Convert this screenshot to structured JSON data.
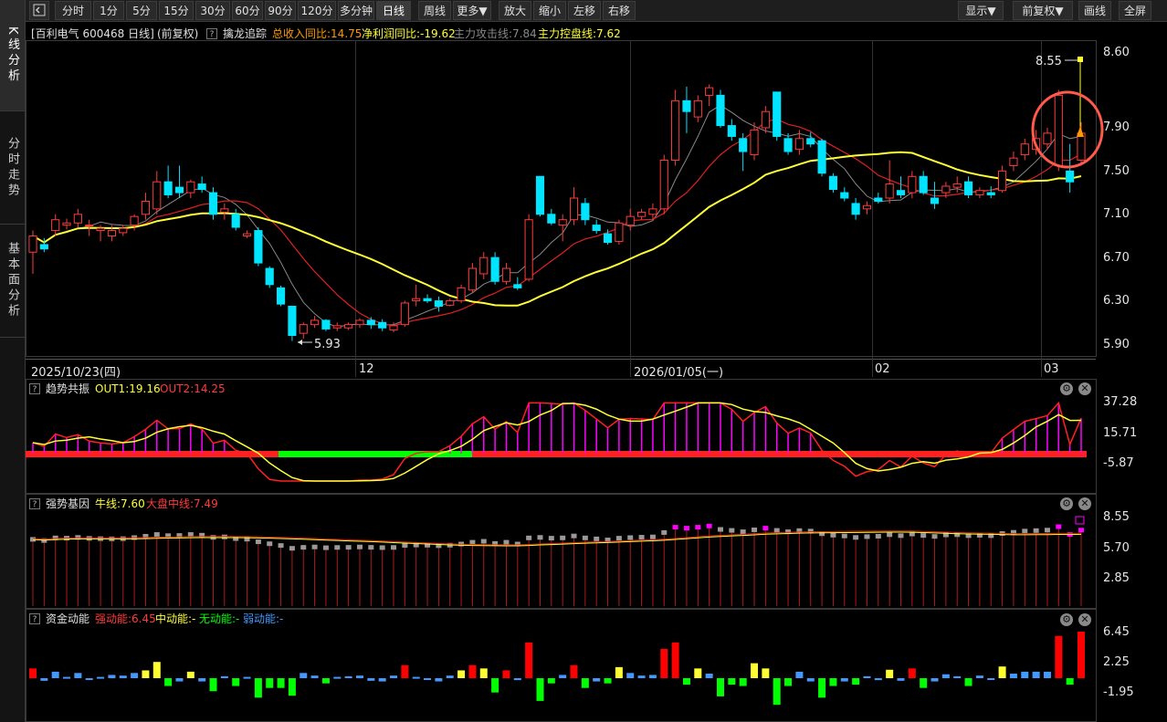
{
  "left_tabs": [
    "K线分析",
    "分时走势",
    "基本面分析"
  ],
  "toolbar": {
    "periods": [
      "分时",
      "1分",
      "5分",
      "15分",
      "30分",
      "60分",
      "90分",
      "120分",
      "多分钟",
      "日线",
      "周线",
      "更多▼",
      "放大",
      "缩小",
      "左移",
      "右移"
    ],
    "selected": "日线",
    "right_buttons": [
      "显示▼",
      "前复权▼",
      "画线",
      "全屏"
    ]
  },
  "main_panel": {
    "stock_label": "[百利电气 600468 日线]",
    "adjust_label": "(前复权)",
    "indicator_name": "擒龙追踪",
    "revenue_yoy": "总收入同比:14.75",
    "profit_yoy": "净利润同比:-19.62",
    "attack_line": "主力攻击线:7.84",
    "control_line": "主力控盘线:7.62",
    "y_ticks": [
      "8.60",
      "7.90",
      "7.50",
      "7.10",
      "6.70",
      "6.30",
      "5.90"
    ],
    "high_marker": "8.55",
    "low_marker": "5.93",
    "x_ticks": [
      "2025/10/23(四)",
      "12",
      "2026/01/05(一)",
      "02",
      "03"
    ]
  },
  "panel2": {
    "name": "趋势共振",
    "out1": "OUT1:19.16",
    "out2": "OUT2:14.25",
    "y_ticks": [
      "37.28",
      "15.71",
      "-5.87"
    ]
  },
  "panel3": {
    "name": "强势基因",
    "bull_line": "牛线:7.60",
    "market_mid": "大盘中线:7.49",
    "y_ticks": [
      "8.55",
      "5.70",
      "2.85"
    ]
  },
  "panel4": {
    "name": "资金动能",
    "strong": "强动能:6.45",
    "mid": "中动能:-",
    "none": "无动能:-",
    "weak": "弱动能:-",
    "y_ticks": [
      "6.45",
      "2.25",
      "-1.95"
    ]
  },
  "colors": {
    "up": "#ff3b3b",
    "down": "#00e5ff",
    "yellow": "#ffff33",
    "magenta": "#ff00ff",
    "green": "#00ff00",
    "orange": "#ff9900",
    "blue": "#4499ff"
  },
  "chart_data": {
    "type": "candlestick",
    "y_range": [
      5.9,
      8.6
    ],
    "bars": [
      {
        "o": 6.75,
        "h": 6.95,
        "l": 6.55,
        "c": 6.9
      },
      {
        "o": 6.82,
        "h": 6.88,
        "l": 6.75,
        "c": 6.78
      },
      {
        "o": 6.95,
        "h": 7.1,
        "l": 6.9,
        "c": 7.05
      },
      {
        "o": 7.0,
        "h": 7.06,
        "l": 6.96,
        "c": 7.02
      },
      {
        "o": 7.02,
        "h": 7.15,
        "l": 6.98,
        "c": 7.1
      },
      {
        "o": 7.0,
        "h": 7.05,
        "l": 6.9,
        "c": 7.0
      },
      {
        "o": 6.95,
        "h": 7.0,
        "l": 6.85,
        "c": 6.97
      },
      {
        "o": 6.9,
        "h": 7.0,
        "l": 6.85,
        "c": 6.95
      },
      {
        "o": 6.93,
        "h": 7.0,
        "l": 6.9,
        "c": 6.97
      },
      {
        "o": 7.0,
        "h": 7.1,
        "l": 6.95,
        "c": 7.08
      },
      {
        "o": 7.1,
        "h": 7.3,
        "l": 7.05,
        "c": 7.22
      },
      {
        "o": 7.15,
        "h": 7.5,
        "l": 7.1,
        "c": 7.4
      },
      {
        "o": 7.4,
        "h": 7.55,
        "l": 7.25,
        "c": 7.28
      },
      {
        "o": 7.35,
        "h": 7.55,
        "l": 7.25,
        "c": 7.3
      },
      {
        "o": 7.3,
        "h": 7.42,
        "l": 7.25,
        "c": 7.4
      },
      {
        "o": 7.38,
        "h": 7.45,
        "l": 7.3,
        "c": 7.33
      },
      {
        "o": 7.3,
        "h": 7.35,
        "l": 7.05,
        "c": 7.1
      },
      {
        "o": 7.12,
        "h": 7.2,
        "l": 7.05,
        "c": 7.15
      },
      {
        "o": 7.1,
        "h": 7.15,
        "l": 6.95,
        "c": 6.98
      },
      {
        "o": 6.9,
        "h": 6.95,
        "l": 6.88,
        "c": 6.92
      },
      {
        "o": 6.95,
        "h": 6.98,
        "l": 6.62,
        "c": 6.65
      },
      {
        "o": 6.6,
        "h": 6.62,
        "l": 6.42,
        "c": 6.45
      },
      {
        "o": 6.42,
        "h": 6.44,
        "l": 6.25,
        "c": 6.27
      },
      {
        "o": 6.25,
        "h": 6.25,
        "l": 5.93,
        "c": 5.98
      },
      {
        "o": 6.0,
        "h": 6.1,
        "l": 5.95,
        "c": 6.08
      },
      {
        "o": 6.08,
        "h": 6.16,
        "l": 6.05,
        "c": 6.12
      },
      {
        "o": 6.12,
        "h": 6.13,
        "l": 6.02,
        "c": 6.04
      },
      {
        "o": 6.05,
        "h": 6.1,
        "l": 6.02,
        "c": 6.07
      },
      {
        "o": 6.05,
        "h": 6.1,
        "l": 6.03,
        "c": 6.08
      },
      {
        "o": 6.08,
        "h": 6.14,
        "l": 6.05,
        "c": 6.12
      },
      {
        "o": 6.12,
        "h": 6.15,
        "l": 6.04,
        "c": 6.08
      },
      {
        "o": 6.1,
        "h": 6.13,
        "l": 6.02,
        "c": 6.05
      },
      {
        "o": 6.03,
        "h": 6.1,
        "l": 6.01,
        "c": 6.07
      },
      {
        "o": 6.08,
        "h": 6.3,
        "l": 6.06,
        "c": 6.28
      },
      {
        "o": 6.3,
        "h": 6.45,
        "l": 6.25,
        "c": 6.32
      },
      {
        "o": 6.32,
        "h": 6.36,
        "l": 6.28,
        "c": 6.3
      },
      {
        "o": 6.3,
        "h": 6.34,
        "l": 6.2,
        "c": 6.25
      },
      {
        "o": 6.26,
        "h": 6.32,
        "l": 6.25,
        "c": 6.3
      },
      {
        "o": 6.3,
        "h": 6.45,
        "l": 6.28,
        "c": 6.42
      },
      {
        "o": 6.4,
        "h": 6.65,
        "l": 6.38,
        "c": 6.6
      },
      {
        "o": 6.55,
        "h": 6.75,
        "l": 6.5,
        "c": 6.7
      },
      {
        "o": 6.7,
        "h": 6.75,
        "l": 6.45,
        "c": 6.48
      },
      {
        "o": 6.48,
        "h": 6.65,
        "l": 6.45,
        "c": 6.6
      },
      {
        "o": 6.45,
        "h": 6.52,
        "l": 6.4,
        "c": 6.42
      },
      {
        "o": 6.5,
        "h": 7.1,
        "l": 6.48,
        "c": 7.05
      },
      {
        "o": 7.45,
        "h": 7.45,
        "l": 7.08,
        "c": 7.1
      },
      {
        "o": 7.1,
        "h": 7.15,
        "l": 7.0,
        "c": 7.02
      },
      {
        "o": 7.0,
        "h": 7.1,
        "l": 6.85,
        "c": 7.05
      },
      {
        "o": 7.05,
        "h": 7.35,
        "l": 7.0,
        "c": 7.25
      },
      {
        "o": 7.2,
        "h": 7.25,
        "l": 7.0,
        "c": 7.05
      },
      {
        "o": 7.0,
        "h": 7.05,
        "l": 6.92,
        "c": 6.95
      },
      {
        "o": 6.92,
        "h": 6.96,
        "l": 6.82,
        "c": 6.84
      },
      {
        "o": 6.85,
        "h": 7.05,
        "l": 6.82,
        "c": 7.02
      },
      {
        "o": 7.0,
        "h": 7.15,
        "l": 6.95,
        "c": 7.08
      },
      {
        "o": 7.08,
        "h": 7.15,
        "l": 7.05,
        "c": 7.12
      },
      {
        "o": 7.1,
        "h": 7.2,
        "l": 7.05,
        "c": 7.15
      },
      {
        "o": 7.15,
        "h": 7.65,
        "l": 7.1,
        "c": 7.6
      },
      {
        "o": 7.6,
        "h": 8.25,
        "l": 7.55,
        "c": 8.15
      },
      {
        "o": 8.15,
        "h": 8.28,
        "l": 7.85,
        "c": 8.05
      },
      {
        "o": 8.0,
        "h": 8.2,
        "l": 7.95,
        "c": 8.15
      },
      {
        "o": 8.2,
        "h": 8.3,
        "l": 8.1,
        "c": 8.27
      },
      {
        "o": 8.2,
        "h": 8.25,
        "l": 7.9,
        "c": 7.92
      },
      {
        "o": 7.92,
        "h": 7.98,
        "l": 7.78,
        "c": 7.82
      },
      {
        "o": 7.8,
        "h": 7.85,
        "l": 7.5,
        "c": 7.68
      },
      {
        "o": 7.65,
        "h": 7.95,
        "l": 7.6,
        "c": 7.88
      },
      {
        "o": 7.9,
        "h": 8.1,
        "l": 7.85,
        "c": 8.05
      },
      {
        "o": 8.23,
        "h": 8.23,
        "l": 7.78,
        "c": 7.82
      },
      {
        "o": 7.8,
        "h": 7.85,
        "l": 7.65,
        "c": 7.68
      },
      {
        "o": 7.7,
        "h": 7.88,
        "l": 7.65,
        "c": 7.8
      },
      {
        "o": 7.8,
        "h": 7.86,
        "l": 7.72,
        "c": 7.75
      },
      {
        "o": 7.78,
        "h": 7.8,
        "l": 7.45,
        "c": 7.48
      },
      {
        "o": 7.45,
        "h": 7.48,
        "l": 7.3,
        "c": 7.33
      },
      {
        "o": 7.3,
        "h": 7.35,
        "l": 7.22,
        "c": 7.25
      },
      {
        "o": 7.2,
        "h": 7.25,
        "l": 7.05,
        "c": 7.1
      },
      {
        "o": 7.15,
        "h": 7.22,
        "l": 7.1,
        "c": 7.18
      },
      {
        "o": 7.25,
        "h": 7.3,
        "l": 7.2,
        "c": 7.22
      },
      {
        "o": 7.25,
        "h": 7.6,
        "l": 7.2,
        "c": 7.38
      },
      {
        "o": 7.32,
        "h": 7.45,
        "l": 7.25,
        "c": 7.28
      },
      {
        "o": 7.3,
        "h": 7.5,
        "l": 7.25,
        "c": 7.45
      },
      {
        "o": 7.45,
        "h": 7.5,
        "l": 7.28,
        "c": 7.3
      },
      {
        "o": 7.25,
        "h": 7.4,
        "l": 7.15,
        "c": 7.2
      },
      {
        "o": 7.3,
        "h": 7.4,
        "l": 7.25,
        "c": 7.36
      },
      {
        "o": 7.35,
        "h": 7.45,
        "l": 7.3,
        "c": 7.38
      },
      {
        "o": 7.4,
        "h": 7.45,
        "l": 7.25,
        "c": 7.28
      },
      {
        "o": 7.28,
        "h": 7.35,
        "l": 7.25,
        "c": 7.32
      },
      {
        "o": 7.3,
        "h": 7.36,
        "l": 7.25,
        "c": 7.28
      },
      {
        "o": 7.32,
        "h": 7.55,
        "l": 7.3,
        "c": 7.5
      },
      {
        "o": 7.55,
        "h": 7.68,
        "l": 7.5,
        "c": 7.62
      },
      {
        "o": 7.65,
        "h": 7.8,
        "l": 7.6,
        "c": 7.75
      },
      {
        "o": 7.7,
        "h": 7.88,
        "l": 7.65,
        "c": 7.8
      },
      {
        "o": 7.75,
        "h": 7.9,
        "l": 7.7,
        "c": 7.85
      },
      {
        "o": 7.55,
        "h": 8.25,
        "l": 7.5,
        "c": 8.2
      },
      {
        "o": 7.5,
        "h": 7.75,
        "l": 7.3,
        "c": 7.4
      },
      {
        "o": 7.6,
        "h": 7.95,
        "l": 7.55,
        "c": 7.85
      }
    ]
  }
}
